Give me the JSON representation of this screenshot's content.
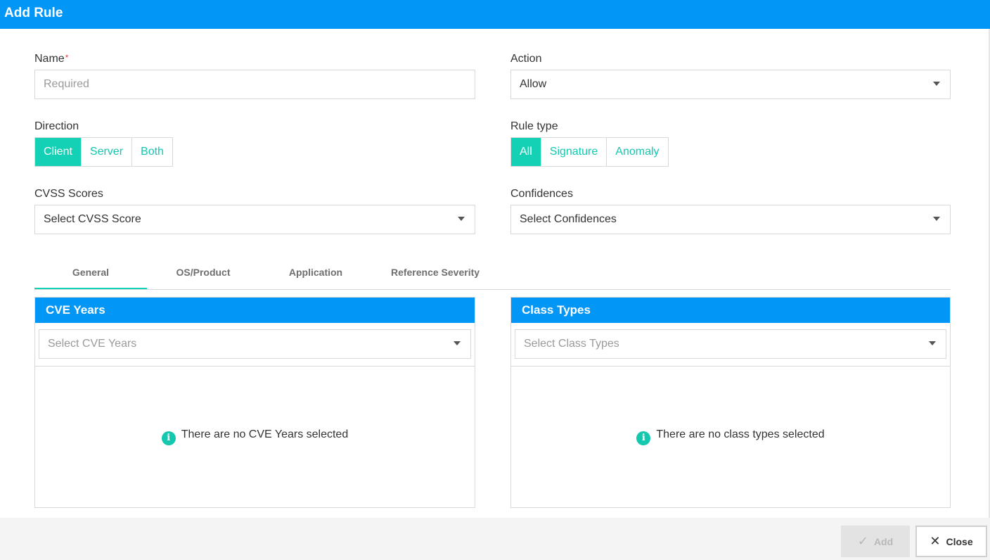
{
  "dialog": {
    "title": "Add Rule"
  },
  "form": {
    "name": {
      "label": "Name",
      "required_mark": "*",
      "placeholder": "Required"
    },
    "action": {
      "label": "Action",
      "value": "Allow"
    },
    "direction": {
      "label": "Direction",
      "options": [
        "Client",
        "Server",
        "Both"
      ],
      "selected": "Client"
    },
    "rule_type": {
      "label": "Rule type",
      "options": [
        "All",
        "Signature",
        "Anomaly"
      ],
      "selected": "All"
    },
    "cvss": {
      "label": "CVSS Scores",
      "placeholder": "Select CVSS Score"
    },
    "confidences": {
      "label": "Confidences",
      "placeholder": "Select Confidences"
    }
  },
  "tabs": [
    {
      "label": "General",
      "active": true
    },
    {
      "label": "OS/Product",
      "active": false
    },
    {
      "label": "Application",
      "active": false
    },
    {
      "label": "Reference Severity",
      "active": false
    }
  ],
  "panels": {
    "cve_years": {
      "title": "CVE Years",
      "placeholder": "Select CVE Years",
      "empty_text": "There are no CVE Years selected"
    },
    "class_types": {
      "title": "Class Types",
      "placeholder": "Select Class Types",
      "empty_text": "There are no class types selected"
    }
  },
  "footer": {
    "add_label": "Add",
    "close_label": "Close"
  },
  "colors": {
    "header_blue": "#0296f6",
    "accent_teal": "#14d0b4",
    "required_red": "#e23c3c"
  },
  "icons": {
    "info": "info-icon",
    "check": "check-icon",
    "close": "close-icon",
    "dropdown": "chevron-down-icon"
  }
}
